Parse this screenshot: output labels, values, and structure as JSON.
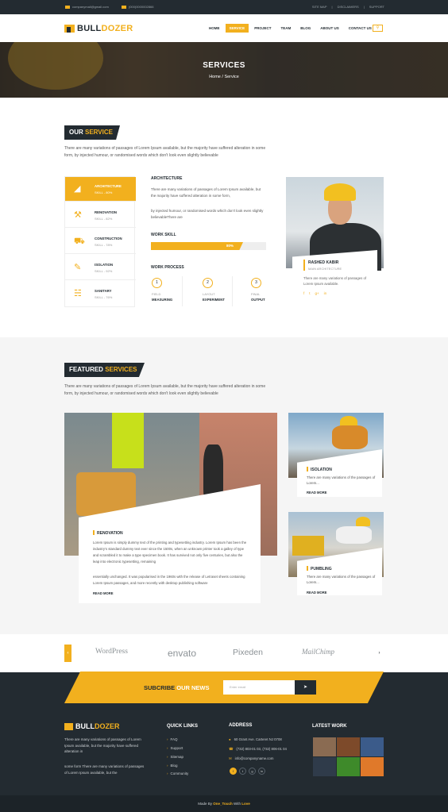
{
  "topbar": {
    "email": "companymail@gmail.com",
    "phone": "(000)0000002866",
    "links": [
      "SITE MAP",
      "DISCLAIMERS",
      "SUPPORT"
    ]
  },
  "logo": {
    "text_a": "BULL",
    "text_b": "DOZER"
  },
  "nav": {
    "items": [
      "HOME",
      "SERVICE",
      "PROJECT",
      "TEAM",
      "BLOG",
      "ABOUT US",
      "CONTACT US"
    ],
    "active": "SERVICE"
  },
  "hero": {
    "title": "SERVICES",
    "breadcrumb": "Home / Service"
  },
  "our_service": {
    "heading_a": "OUR ",
    "heading_b": "SERVICE",
    "intro": "There are many variations of passages of Lorem Ipsum available, but the majority have suffered alteration in some form, by injected humour, or randomised words which don't look even slightly believable",
    "list": [
      {
        "name": "ARCHITECTURE",
        "skill": "SKILL - 80%",
        "icon": "ruler-triangle-icon"
      },
      {
        "name": "RENOVATION",
        "skill": "SKILL - 82%",
        "icon": "hammer-icon"
      },
      {
        "name": "CONSTRUCTION",
        "skill": "SKILL - 78%",
        "icon": "wheelbarrow-icon"
      },
      {
        "name": "ISOLATION",
        "skill": "SKILL - 92%",
        "icon": "trowel-icon"
      },
      {
        "name": "SANITARY",
        "skill": "SKILL - 76%",
        "icon": "pipe-icon"
      }
    ],
    "detail_title": "ARCHITECTURE",
    "detail_p1": "There are many variations of passages of Lorem Ipsum available, but the majority have suffered alteration in some form,",
    "detail_p2": "by injected humour, or randomised words which don't look even slightly believableThere are",
    "work_skill_label": "WORK SKILL",
    "work_skill_value": 0.8,
    "work_skill_text": "80%",
    "work_process_label": "WORK PROCESS",
    "steps": [
      {
        "num": "1",
        "a": "FIELD",
        "b": "MEASURING"
      },
      {
        "num": "2",
        "a": "LAYOUT",
        "b": "EXPERIMENT"
      },
      {
        "num": "3",
        "a": "FINAL",
        "b": "OUTPUT"
      }
    ],
    "person": {
      "name": "RASHED KABIR",
      "role": "MAIN ARCHITECTURE",
      "desc": "There are many variations of passages of Lorem Ipsum available.",
      "social": [
        "f",
        "t",
        "g+",
        "in"
      ]
    }
  },
  "featured": {
    "heading_a": "FEATURED ",
    "heading_b": "SERVICES",
    "intro": "There are many variations of passages of Lorem Ipsum available, but the majority have suffered alteration in some form, by injected humour, or randomised words which don't look even slightly believable",
    "big": {
      "title": "RENOVATION",
      "p1": "Lorem Ipsum is simply dummy text of the printing and typesetting industry. Lorem Ipsum has been the industry's standard dummy text ever since the 1500s, when an unknown printer took a galley of type and scrambled it to make a type specimen book. It has survived not only five centuries, but also the leap into electronic typesetting, remaining",
      "p2": "essentially unchanged. It was popularised in the 1960s with the release of Letraset sheets containing Lorem Ipsum passages, and more recently with desktop publishing software",
      "more": "READ MORE"
    },
    "small": [
      {
        "title": "ISOLATION",
        "desc": "There are many variations of the passages of Lorem...",
        "more": "READ MORE"
      },
      {
        "title": "PUMBLING",
        "desc": "There are many variations of the passages of Lorem...",
        "more": "READ MORE"
      }
    ]
  },
  "partners": [
    "WordPress",
    "envato",
    "Pixeden",
    "MailChimp"
  ],
  "subscribe": {
    "a": "SUBCRIBE ",
    "b": "OUR NEWS",
    "placeholder": "Enter email"
  },
  "footer": {
    "about1": "There are many variations of passages of Lorem Ipsum available, but the majority have suffered alteration in",
    "about2": "some form There are many variations of passages of Lorem Ipsum available, but the",
    "quick_title": "QUICK LINKS",
    "quick": [
      "FAQ",
      "Support",
      "Sitemap",
      "Blog",
      "Community"
    ],
    "address_title": "ADDRESS",
    "address": [
      "60 Grant Ave. Carteret NJ 0708",
      "(732) 803-01 03, (732) 806-01 04",
      "info@companyname.com"
    ],
    "social": [
      "f",
      "t",
      "g",
      "in"
    ],
    "latest_title": "LATEST WORK",
    "latest_colors": [
      "#8a6b52",
      "#7d4a2a",
      "#3b5b8a",
      "#2f3b4a",
      "#3e8a2a",
      "#e0792a"
    ]
  },
  "copyright": {
    "a": "Made By ",
    "b": "One_Touch",
    "c": " With ",
    "d": "Love"
  }
}
